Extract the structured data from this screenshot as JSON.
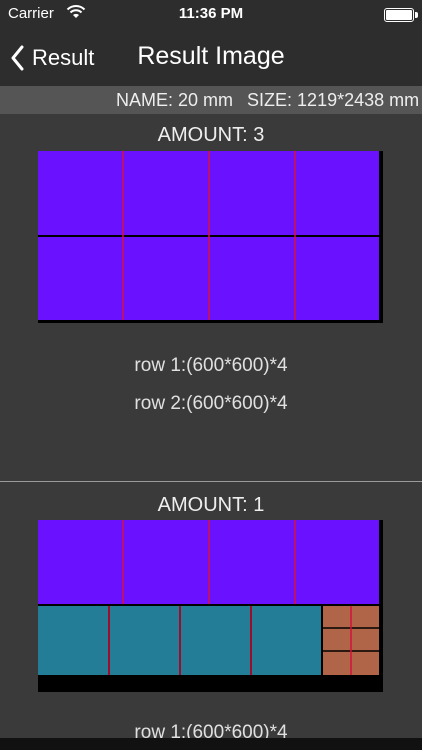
{
  "status_bar": {
    "carrier": "Carrier",
    "time": "11:36 PM"
  },
  "nav": {
    "back_label": "Result",
    "title": "Result Image"
  },
  "info": {
    "name": "NAME: 20 mm",
    "size": "SIZE: 1219*2438 mm"
  },
  "results": [
    {
      "amount": "AMOUNT: 3",
      "rows": [
        "row 1:(600*600)*4",
        "row 2:(600*600)*4"
      ]
    },
    {
      "amount": "AMOUNT: 1",
      "rows": [
        "row 1:(600*600)*4"
      ]
    }
  ],
  "colors": {
    "purple_piece": "#6a12ff",
    "teal_piece": "#237d96",
    "brown_piece": "#b06548",
    "cut_line": "#d6103a",
    "sheet": "#000000"
  }
}
